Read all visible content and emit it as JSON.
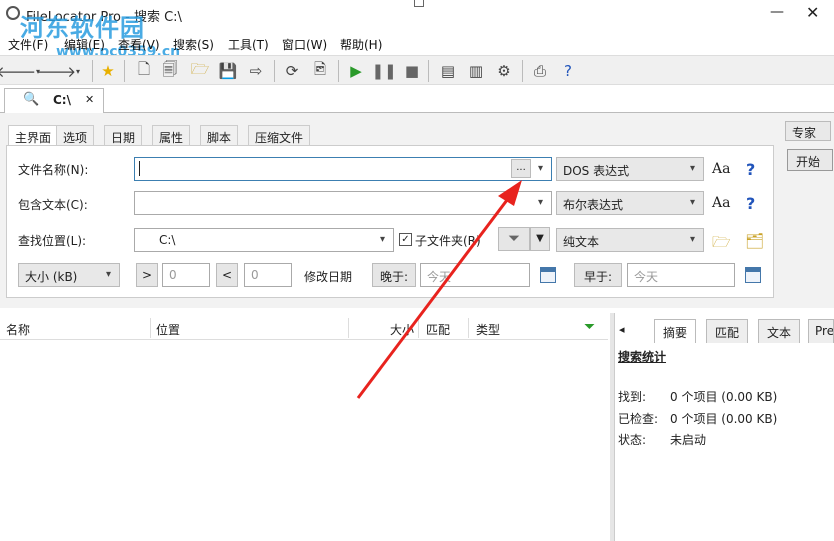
{
  "window": {
    "title": "FileLocator Pro - 搜索 C:\\",
    "watermark": "河东软件园",
    "watermark_url": "www.pc0359.cn"
  },
  "menu": [
    "文件(F)",
    "编辑(E)",
    "查看(V)",
    "搜索(S)",
    "工具(T)",
    "窗口(W)",
    "帮助(H)"
  ],
  "doc_tab": {
    "label": "C:\\",
    "close": "✕"
  },
  "subtabs": [
    "主界面",
    "选项",
    "日期",
    "属性",
    "脚本",
    "压缩文件"
  ],
  "form": {
    "filename_label": "文件名称(N):",
    "filename_value": "",
    "browse_label": "...",
    "filename_mode": "DOS 表达式",
    "contains_label": "包含文本(C):",
    "contains_value": "",
    "contains_mode": "布尔表达式",
    "location_label": "查找位置(L):",
    "location_value": "C:\\",
    "subfolders_label": "子文件夹(R)",
    "subfolders_checked": true,
    "text_mode": "纯文本",
    "size_label": "大小 (kB)",
    "gt_label": ">",
    "gt_value": "0",
    "lt_label": "<",
    "lt_value": "0",
    "modified_label": "修改日期",
    "after_label": "晚于:",
    "after_value": "今天",
    "before_label": "早于:",
    "before_value": "今天",
    "aa_label": "Aa",
    "help_label": "?"
  },
  "side": {
    "expert": "专家",
    "start": "开始"
  },
  "results_columns": [
    "名称",
    "位置",
    "大小",
    "匹配",
    "类型"
  ],
  "right_tabs": [
    "摘要",
    "匹配",
    "文本",
    "Pre"
  ],
  "summary": {
    "heading": "搜索统计",
    "found_label": "找到:",
    "found_value": "0 个项目 (0.00 KB)",
    "checked_label": "已检查:",
    "checked_value": "0 个项目 (0.00 KB)",
    "status_label": "状态:",
    "status_value": "未启动"
  },
  "colors": {
    "accent": "#2a9de0",
    "arrow": "#e8231e",
    "focus_border": "#3c7fb1"
  }
}
